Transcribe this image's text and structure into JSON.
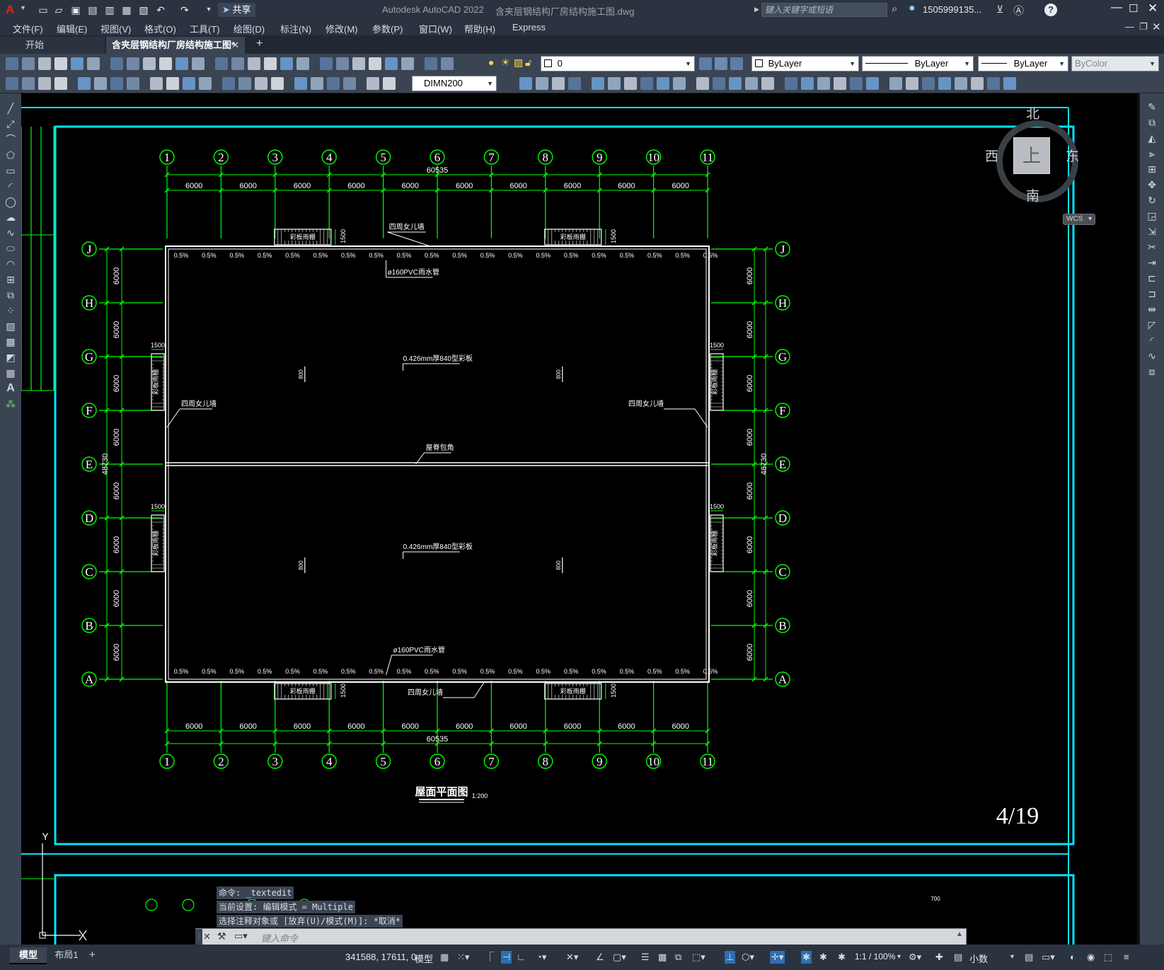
{
  "app": {
    "product": "Autodesk AutoCAD 2022",
    "filename": "含夹层钢结构厂房结构施工图.dwg",
    "share_label": "共享",
    "search_placeholder": "键入关键字或短语",
    "user": "1505999135...",
    "help": "?"
  },
  "menu": [
    "文件(F)",
    "编辑(E)",
    "视图(V)",
    "格式(O)",
    "工具(T)",
    "绘图(D)",
    "标注(N)",
    "修改(M)",
    "参数(P)",
    "窗口(W)",
    "帮助(H)",
    "Express"
  ],
  "tabs": {
    "start": "开始",
    "active": "含夹层钢结构厂房结构施工图*",
    "close": "✕",
    "add": "+"
  },
  "toolbar": {
    "layer": "0",
    "color": "ByLayer",
    "linetype": "ByLayer",
    "lineweight": "ByLayer",
    "plotstyle": "ByColor",
    "dimstyle": "DIMN200"
  },
  "viewcube": {
    "north": "北",
    "south": "南",
    "east": "东",
    "west": "西",
    "top": "上",
    "wcs": "WCS"
  },
  "drawing": {
    "col_labels": [
      "1",
      "2",
      "3",
      "4",
      "5",
      "6",
      "7",
      "8",
      "9",
      "10",
      "11"
    ],
    "row_labels": [
      "J",
      "H",
      "G",
      "F",
      "E",
      "D",
      "C",
      "B",
      "A"
    ],
    "bay": "6000",
    "total_x": "60535",
    "total_y": "48730",
    "slope": "0.5%",
    "slope_count_top": 20,
    "slope_count_bottom": 20,
    "gutter_top": "四周女儿墙",
    "pvc": "ø160PVC雨水管",
    "pvc_bottom": "ø160PVC雨水管",
    "parapet": "四周女儿墙",
    "parapet_left": "四周女儿墙",
    "parapet_right": "四周女儿墙",
    "ridge": "屋脊包角",
    "panel_upper": "0.426mm厚840型彩板",
    "panel_lower": "0.426mm厚840型彩板",
    "canopy": "彩板雨棚",
    "canopy_dim": "1500",
    "title": "屋面平面图",
    "scale": "1:200",
    "sheet": "4/19",
    "ucs_y": "Y",
    "mark": "800",
    "partial": "700"
  },
  "command": {
    "line1": "命令: _textedit",
    "line2": "当前设置: 编辑模式 = Multiple",
    "line3": "选择注释对象或 [放弃(U)/模式(M)]: *取消*",
    "placeholder": "键入命令"
  },
  "status": {
    "model_tab": "模型",
    "layout_tab": "布局1",
    "coords": "341588, 17611, 0",
    "model": "模型",
    "scale": "1:1 / 100%",
    "units": "小数"
  },
  "colors": {
    "cyan": "#00e5ff",
    "grid_green": "#00ff00",
    "white": "#ffffff",
    "chrome": "#2b3340"
  }
}
